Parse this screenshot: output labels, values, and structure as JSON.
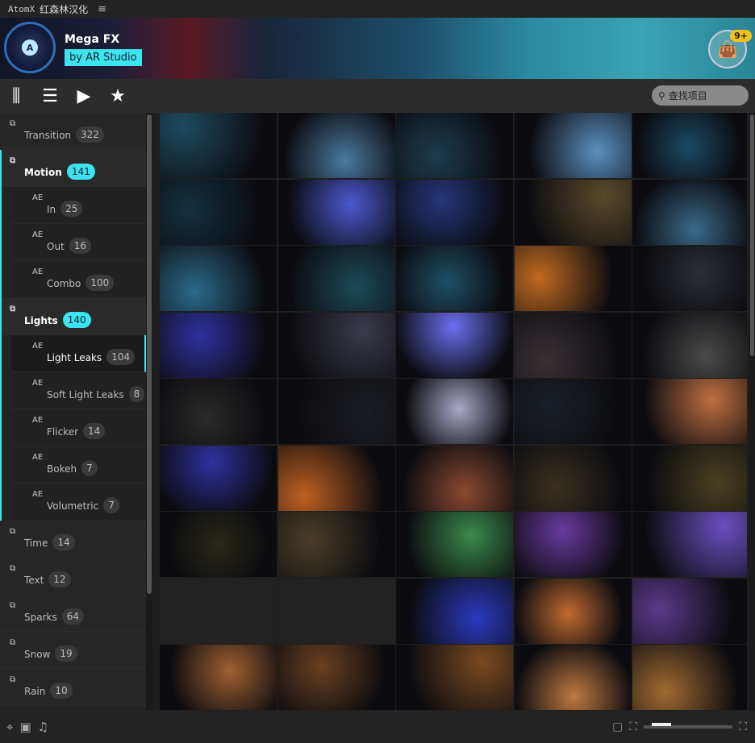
{
  "titlebar": {
    "app": "AtomX",
    "title": "红森林汉化",
    "menu_icon": "hamburger-icon"
  },
  "header": {
    "product": "Mega FX",
    "studio": "by AR Studio",
    "cart_badge": "9+"
  },
  "toolbar": {
    "search_placeholder": "查找项目"
  },
  "sidebar": [
    {
      "label": "Transition",
      "count": "322",
      "level": "top"
    },
    {
      "label": "Motion",
      "count": "141",
      "level": "top",
      "open": true
    },
    {
      "label": "In",
      "count": "25",
      "level": "sub"
    },
    {
      "label": "Out",
      "count": "16",
      "level": "sub"
    },
    {
      "label": "Combo",
      "count": "100",
      "level": "sub"
    },
    {
      "label": "Lights",
      "count": "140",
      "level": "top",
      "open": true
    },
    {
      "label": "Light Leaks",
      "count": "104",
      "level": "sub",
      "selected": true
    },
    {
      "label": "Soft Light Leaks",
      "count": "8",
      "level": "sub"
    },
    {
      "label": "Flicker",
      "count": "14",
      "level": "sub"
    },
    {
      "label": "Bokeh",
      "count": "7",
      "level": "sub"
    },
    {
      "label": "Volumetric",
      "count": "7",
      "level": "sub"
    },
    {
      "label": "Time",
      "count": "14",
      "level": "top"
    },
    {
      "label": "Text",
      "count": "12",
      "level": "top"
    },
    {
      "label": "Sparks",
      "count": "64",
      "level": "top"
    },
    {
      "label": "Snow",
      "count": "19",
      "level": "top"
    },
    {
      "label": "Rain",
      "count": "10",
      "level": "top"
    }
  ],
  "colors": {
    "accent": "#3de3ef",
    "badge": "#f4c21a"
  },
  "thumbnails": [
    "#1d4a60",
    "#4a7aa0",
    "#1c3d50",
    "#5a90c0",
    "#1a4a66",
    "#123040",
    "#4a5ad0",
    "#24367a",
    "#5a4a2a",
    "#3a6a8a",
    "#2a6a8a",
    "#1c4a5a",
    "#1e5068",
    "#c06a20",
    "#2a2e36",
    "#3030a0",
    "#3a3a4a",
    "#6a70f0",
    "#3a3034",
    "#4a4a4a",
    "#2a2a2a",
    "#1a1c22",
    "#a8a8c8",
    "#1a2028",
    "#c07040",
    "#3030a0",
    "#c06020",
    "#8a4a30",
    "#3a3020",
    "#4a4020",
    "#2a2818",
    "#4a3e28",
    "#3a8a4a",
    "#6a3aa0",
    "#6a50c0",
    "",
    "",
    "#2a3ac0",
    "#c06a30",
    "#5a3a8a",
    "#a06030",
    "#6a4020",
    "#7a4a20",
    "#c07a40",
    "#a06a30"
  ]
}
